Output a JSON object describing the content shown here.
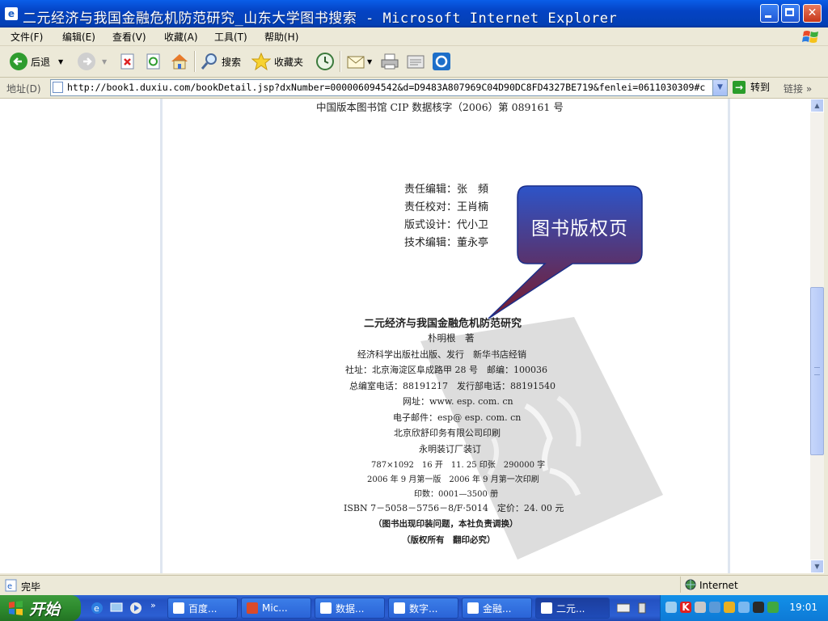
{
  "window": {
    "title": "二元经济与我国金融危机防范研究_山东大学图书搜索 - Microsoft Internet Explorer"
  },
  "menu": [
    "文件(F)",
    "编辑(E)",
    "查看(V)",
    "收藏(A)",
    "工具(T)",
    "帮助(H)"
  ],
  "toolbar": {
    "back": "后退",
    "search": "搜索",
    "favorites": "收藏夹"
  },
  "address": {
    "label": "地址(D)",
    "url": "http://book1.duxiu.com/bookDetail.jsp?dxNumber=000006094542&d=D9483A807969C04D90DC8FD4327BE719&fenlei=0611030309#c",
    "go": "转到",
    "links": "链接"
  },
  "document": {
    "cip": "中国版本图书馆 CIP 数据核字（2006）第 089161 号",
    "credits": [
      "责任编辑：张　頻",
      "责任校对：王肖楠",
      "版式设计：代小卫",
      "技术编辑：董永亭"
    ],
    "book_title": "二元经济与我国金融危机防范研究",
    "author": "朴明根　著",
    "lines": [
      "经济科学出版社出版、发行　新华书店经销",
      "社址：北京海淀区阜成路甲 28 号　邮编：100036",
      "总编室电话：88191217　发行部电话：88191540",
      "网址：www. esp. com. cn",
      "电子邮件：esp@ esp. com. cn",
      "北京欣舒印务有限公司印刷",
      "永明装订厂装订",
      "787×1092　16 开　11. 25 印张　290000 字",
      "2006 年 9 月第一版　2006 年 9 月第一次印刷",
      "印数：0001—3500 册",
      "ISBN 7－5058－5756－8/F·5014　定价：24. 00 元",
      "（图书出现印装问题，本社负责调换）",
      "（版权所有　翻印必究）"
    ]
  },
  "callout": {
    "text": "图书版权页",
    "color_top": "#2d54c8",
    "color_bottom": "#7a1a2a"
  },
  "status": {
    "text": "完毕",
    "zone": "Internet"
  },
  "taskbar": {
    "start": "开始",
    "tasks": [
      "百度...",
      "Mic...",
      "数据...",
      "数字...",
      "金融...",
      "二元..."
    ],
    "clock": "19:01"
  }
}
